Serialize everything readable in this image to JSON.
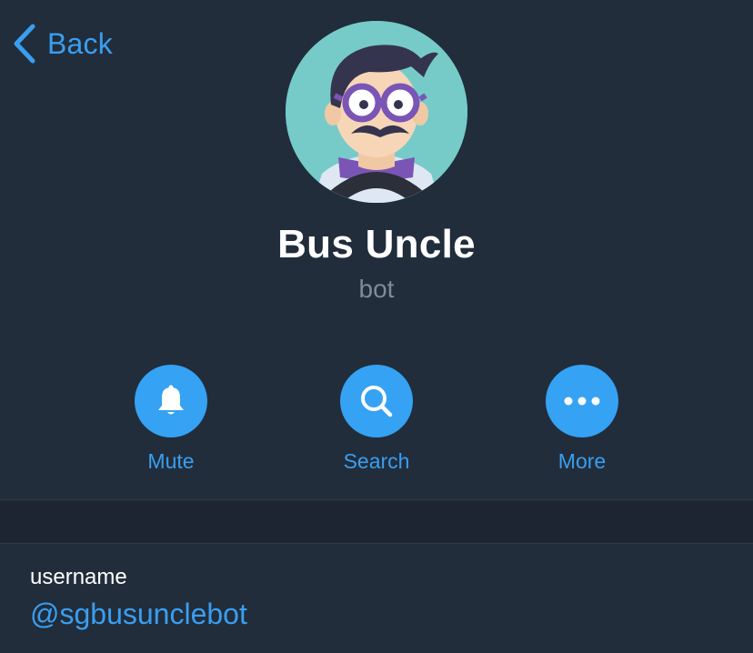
{
  "nav": {
    "back_label": "Back"
  },
  "profile": {
    "name": "Bus Uncle",
    "subtitle": "bot"
  },
  "actions": [
    {
      "label": "Mute",
      "icon": "bell-icon"
    },
    {
      "label": "Search",
      "icon": "search-icon"
    },
    {
      "label": "More",
      "icon": "more-dots-icon"
    }
  ],
  "info": {
    "username_label": "username",
    "username_value": "@sgbusunclebot"
  },
  "colors": {
    "background": "#212d3b",
    "accent": "#3a9ef0",
    "button_fill": "#35a2f3",
    "separator_band": "#1c2531",
    "muted_text": "#7e8b99"
  }
}
